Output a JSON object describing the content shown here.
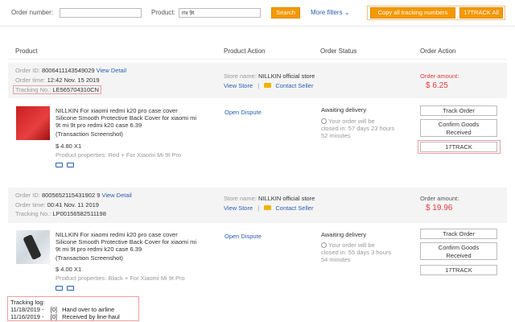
{
  "topbar": {
    "order_number_label": "Order number:",
    "order_number_value": "",
    "product_label": "Product:",
    "product_value": "mi 9t",
    "search_label": "Search",
    "more_filters_label": "More filters",
    "copy_all_label": "Copy all tracking numbers",
    "track_all_label": "17TRACK All"
  },
  "columns": {
    "product": "Product",
    "product_action": "Product Action",
    "order_status": "Order Status",
    "order_action": "Order Action"
  },
  "orders": [
    {
      "order_id_label": "Order ID:",
      "order_id": "8006411143549029",
      "view_detail": "View Detail",
      "order_time_label": "Order time:",
      "order_time": "12:42 Nov. 15 2019",
      "tracking_label": "Tracking No.:",
      "tracking_no": "LE565704310CN",
      "store_label": "Store name:",
      "store_name": "NILLKIN official store",
      "view_store": "View Store",
      "contact_seller": "Contact Seller",
      "amount_label": "Order amount:",
      "amount": "$ 6.25",
      "title_lines": [
        "NILLKIN For xiaomi redmi k20 pro case cover",
        "Silicone Smooth Protective Back Cover for xiaomi mi",
        "9t mi 9t pro redmi k20 case 6.39"
      ],
      "screenshot_label": "(Transaction Screenshot)",
      "price": "$ 4.80 X1",
      "properties": "Product properties: Red + For Xiaomi Mi 9t Pro",
      "open_dispute": "Open Dispute",
      "status": "Awaiting delivery",
      "closing_lines": [
        "Your order will be",
        "closed in: 57 days 23 hours",
        "52 minutes"
      ],
      "track_order": "Track Order",
      "confirm_goods": [
        "Confirm Goods",
        "Received"
      ],
      "track17": "17TRACK"
    },
    {
      "order_id_label": "Order ID:",
      "order_id": "8005652115431902 9",
      "view_detail": "View Detail",
      "order_time_label": "Order time:",
      "order_time": "00:41 Nov. 11 2019",
      "tracking_label": "Tracking No.:",
      "tracking_no": "LP00156582511198",
      "store_label": "Store name:",
      "store_name": "NILLKIN official store",
      "view_store": "View Store",
      "contact_seller": "Contact Seller",
      "amount_label": "Order amount:",
      "amount": "$ 19.96",
      "title_lines": [
        "NILLKIN For xiaomi redmi k20 pro case cover",
        "Silicone Smooth Protective Back Cover for xiaomi mi",
        "9t mi 9t pro redmi k20 case 6.39"
      ],
      "screenshot_label": "(Transaction Screenshot)",
      "price": "$ 4.00 X1",
      "properties": "Product properties: Black + For Xiaomi Mi 9t Pro",
      "open_dispute": "Open Dispute",
      "status": "Awaiting delivery",
      "closing_lines": [
        "Your order will be",
        "closed in: 55 days 3 hours",
        "54 minutes"
      ],
      "track_order": "Track Order",
      "confirm_goods": [
        "Confirm Goods",
        "Received"
      ],
      "track17": "17TRACK"
    }
  ],
  "tracking_log": {
    "title": "Tracking log:",
    "entries": [
      {
        "date": "11/18/2019 -",
        "code": "[0]",
        "text": "Hand over to airline"
      },
      {
        "date": "11/16/2019 -",
        "code": "[0]",
        "text": "Received by line-haul"
      }
    ]
  },
  "colors": {
    "accent": "#f39800",
    "price": "#e4393c",
    "link": "#2a5db0"
  }
}
